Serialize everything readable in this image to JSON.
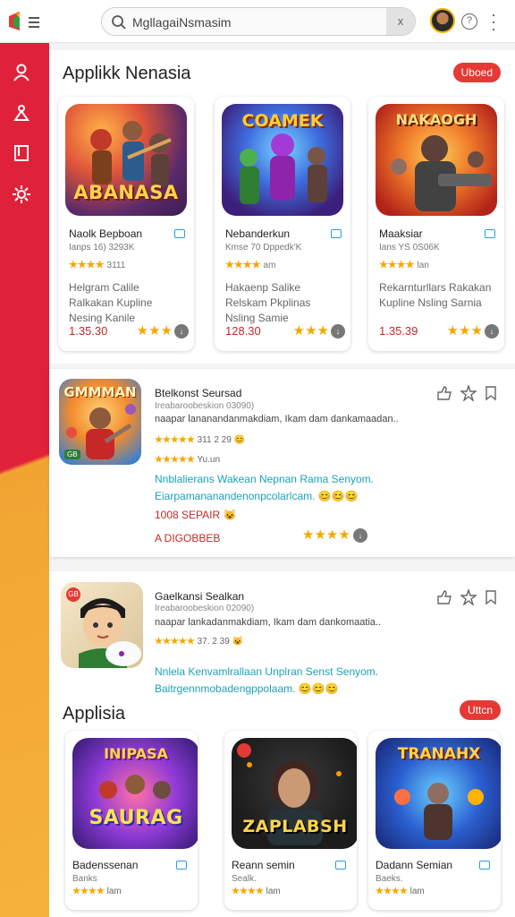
{
  "search": {
    "value": "MgllagaiNsmasim",
    "clear_label": "x"
  },
  "colors": {
    "accent": "#e53935",
    "rail_top": "#e0213a",
    "rail_bottom": "#f5b23a",
    "link": "#1aa3b8"
  },
  "section1": {
    "title": "Applikk Nenasia",
    "pill": "Uboed",
    "cards": [
      {
        "art_text": "ABANASA",
        "name": "Naolk Bepboan",
        "meta": "Ianps 16) 3293K",
        "stars": "★★★★",
        "stars_count": "3111",
        "desc": "Helgram Calile Ralkakan Kupline Nesing Kanile",
        "price": "1.35.30",
        "rating": "★★★"
      },
      {
        "art_text": "COAMEK",
        "name": "Nebanderkun",
        "meta": "Kmse 70 Dppedk'K",
        "stars": "★★★★",
        "stars_count": "am",
        "desc": "Hakaenp Salike Relskam Pkplinas Nsling Samie",
        "price": "128.30",
        "rating": "★★★"
      },
      {
        "art_text": "NAKAOGH",
        "name": "Maaksiar",
        "meta": "Ians YS 0S06K",
        "stars": "★★★★",
        "stars_count": "lan",
        "desc": "Rekarnturllars Rakakan Kupline Nsling Sarnia",
        "price": "1.35.39",
        "rating": "★★★"
      }
    ]
  },
  "row1": {
    "icon_text": "GMMMAN",
    "icon_badge": "GB",
    "title": "Btelkonst Seursad",
    "sub": "Ireabaroobeskion 03090)",
    "text": "naapar lananandanmakdiam, Ikam dam dankamaadan..",
    "stars1": "★★★★★",
    "stars1_value": "311 2 29",
    "stars2": "★★★★★",
    "stars2_value": "Yu.un",
    "link1": "Nnblalierans Wakean Nepnan Rama Senyom.",
    "link2": "Eiarpamananandenonpcolarlcam.",
    "red1": "1008 SEPAIR",
    "red2": "A DIGOBBEB",
    "rating": "★★★★"
  },
  "row2": {
    "icon_badge": "GB",
    "title": "Gaelkansi Sealkan",
    "sub": "Ireabaroobeskion 02090)",
    "text": "naapar lankadanmakdiam, Ikam dam dankomaatia..",
    "stars1": "★★★★★",
    "stars1_value": "37. 2 39",
    "link1": "Nnlela Kenvamlrallaan Unplran Senst Senyom.",
    "link2": "Baitrgennmobadengppolaam."
  },
  "section2": {
    "title": "Applisia",
    "pill": "Uttcn",
    "cards": [
      {
        "art_top": "INIPASA",
        "art_text": "SAURAG",
        "name": "Badenssenan",
        "meta": "Banks",
        "stars": "★★★★",
        "stars_count": "lam"
      },
      {
        "art_text": "ZAPLABSH",
        "name": "Reann semin",
        "meta": "Sealk.",
        "stars": "★★★★",
        "stars_count": "lam"
      },
      {
        "art_text": "TRANAHX",
        "name": "Dadann Semian",
        "meta": "Baeks.",
        "stars": "★★★★",
        "stars_count": "lam"
      }
    ]
  },
  "icons": [
    "app-logo-icon",
    "search-icon",
    "clear-icon",
    "help-icon",
    "more-icon",
    "user-icon",
    "hub-icon",
    "book-icon",
    "settings-icon",
    "bookmark-icon",
    "download-icon",
    "like-icon",
    "star-icon"
  ]
}
